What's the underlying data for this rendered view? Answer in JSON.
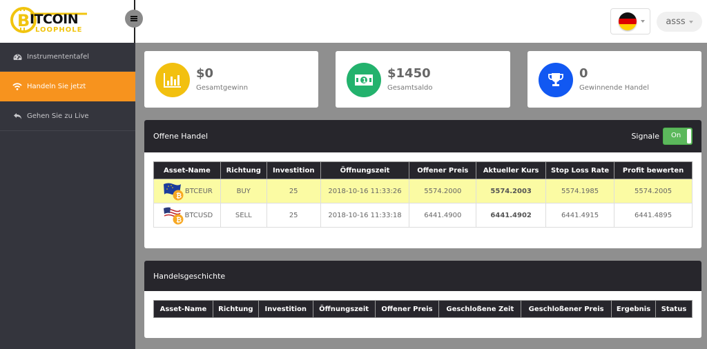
{
  "brand": {
    "line1": "ITCOIN",
    "line2": "LOOPHOLE",
    "accent": "#f1c40f"
  },
  "header": {
    "language_flag": "flag-germany",
    "user_label": "asss"
  },
  "sidebar": {
    "items": [
      {
        "label": "Instrumententafel",
        "icon": "dashboard-icon",
        "active": false
      },
      {
        "label": "Handeln Sie jetzt",
        "icon": "wifi-icon",
        "active": true
      },
      {
        "label": "Gehen Sie zu Live",
        "icon": "reply-arrow-icon",
        "active": false
      }
    ],
    "active_color": "#f7931e"
  },
  "stats": [
    {
      "value": "$0",
      "label": "Gesamtgewinn",
      "icon": "bar-chart-icon",
      "color": "#f2c00f"
    },
    {
      "value": "$1450",
      "label": "Gesamtsaldo",
      "icon": "money-bill-icon",
      "color": "#23b26d"
    },
    {
      "value": "0",
      "label": "Gewinnende Handel",
      "icon": "trophy-icon",
      "color": "#1158f2"
    }
  ],
  "open_trades": {
    "title": "Offene Handel",
    "signals_label": "Signale",
    "signals_state": "On",
    "columns": [
      "Asset-Name",
      "Richtung",
      "Investition",
      "Öffnungszeit",
      "Offener Preis",
      "Aktueller Kurs",
      "Stop Loss Rate",
      "Profit bewerten"
    ],
    "rows": [
      {
        "asset": "BTCEUR",
        "flag": "eu",
        "direction": "BUY",
        "investment": "25",
        "open_time": "2018-10-16 11:33:26",
        "open_price": "5574.2000",
        "current_rate": "5574.2003",
        "stop_loss": "5574.1985",
        "profit": "5574.2005",
        "highlighted": true
      },
      {
        "asset": "BTCUSD",
        "flag": "us",
        "direction": "SELL",
        "investment": "25",
        "open_time": "2018-10-16 11:33:18",
        "open_price": "6441.4900",
        "current_rate": "6441.4902",
        "stop_loss": "6441.4915",
        "profit": "6441.4895",
        "highlighted": false
      }
    ]
  },
  "history": {
    "title": "Handelsgeschichte",
    "columns": [
      "Asset-Name",
      "Richtung",
      "Investition",
      "Öffnungszeit",
      "Offener Preis",
      "Geschloßene Zeit",
      "Geschloßener Preis",
      "Ergebnis",
      "Status"
    ]
  }
}
